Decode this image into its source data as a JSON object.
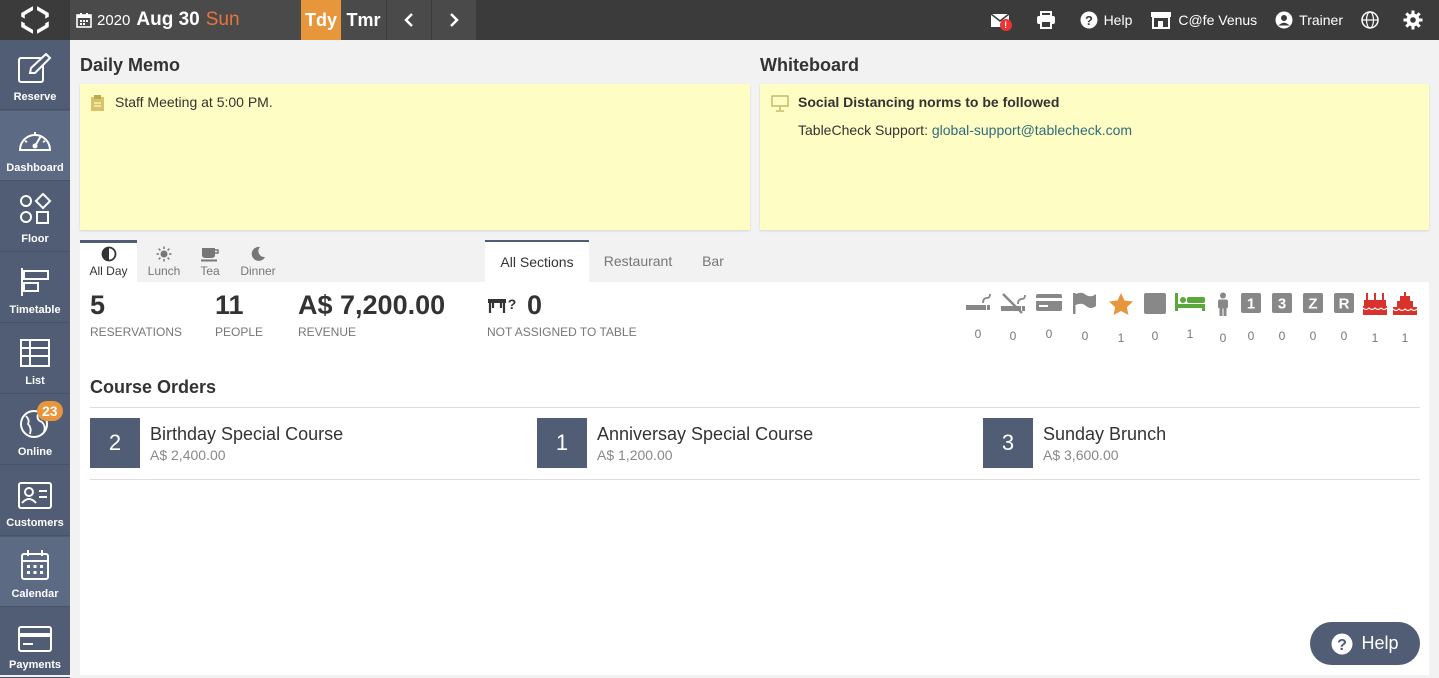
{
  "header": {
    "date_year": "2020",
    "date_monthday": "Aug 30",
    "date_weekday": "Sun",
    "today_label": "Tdy",
    "tomorrow_label": "Tmr",
    "mail_badge": "!",
    "help_label": "Help",
    "store_label": "C@fe Venus",
    "user_label": "Trainer"
  },
  "sidebar": {
    "items": [
      {
        "label": "Reserve",
        "icon": "edit-icon"
      },
      {
        "label": "Dashboard",
        "icon": "gauge-icon"
      },
      {
        "label": "Floor",
        "icon": "floor-icon"
      },
      {
        "label": "Timetable",
        "icon": "timetable-icon"
      },
      {
        "label": "List",
        "icon": "list-icon"
      },
      {
        "label": "Online",
        "icon": "globe-icon",
        "badge": "23"
      },
      {
        "label": "Customers",
        "icon": "customers-icon"
      },
      {
        "label": "Calendar",
        "icon": "calendar-icon"
      },
      {
        "label": "Payments",
        "icon": "card-icon"
      }
    ]
  },
  "memo": {
    "title": "Daily Memo",
    "text": "Staff Meeting at 5:00 PM."
  },
  "whiteboard": {
    "title": "Whiteboard",
    "headline": "Social Distancing norms to be followed",
    "support_prefix": "TableCheck Support: ",
    "support_email": "global-support@tablecheck.com"
  },
  "time_tabs": [
    "All Day",
    "Lunch",
    "Tea",
    "Dinner"
  ],
  "section_tabs": [
    "All Sections",
    "Restaurant",
    "Bar"
  ],
  "stats": {
    "reservations_value": "5",
    "reservations_label": "RESERVATIONS",
    "people_value": "11",
    "people_label": "PEOPLE",
    "revenue_value": "A$ 7,200.00",
    "revenue_label": "REVENUE",
    "unassigned_value": "0",
    "unassigned_label": "NOT ASSIGNED TO TABLE"
  },
  "attributes": [
    {
      "icon": "smoking-icon",
      "count": "0"
    },
    {
      "icon": "no-smoking-icon",
      "count": "0"
    },
    {
      "icon": "card-icon",
      "count": "0"
    },
    {
      "icon": "flag-icon",
      "count": "0"
    },
    {
      "icon": "star-icon",
      "count": "1"
    },
    {
      "icon": "square-icon",
      "count": "0"
    },
    {
      "icon": "bed-icon",
      "count": "1"
    },
    {
      "icon": "person-icon",
      "count": "0"
    },
    {
      "icon": "one-icon",
      "count": "0",
      "text": "1"
    },
    {
      "icon": "three-icon",
      "count": "0",
      "text": "3"
    },
    {
      "icon": "z-icon",
      "count": "0",
      "text": "Z"
    },
    {
      "icon": "r-icon",
      "count": "0",
      "text": "R"
    },
    {
      "icon": "birthday-cake-icon",
      "count": "1"
    },
    {
      "icon": "anniversary-cake-icon",
      "count": "1"
    }
  ],
  "courses": {
    "title": "Course Orders",
    "items": [
      {
        "qty": "2",
        "name": "Birthday Special Course",
        "price": "A$ 2,400.00"
      },
      {
        "qty": "1",
        "name": "Anniversay Special Course",
        "price": "A$ 1,200.00"
      },
      {
        "qty": "3",
        "name": "Sunday Brunch",
        "price": "A$ 3,600.00"
      }
    ]
  },
  "help_button": "Help",
  "colors": {
    "sidebar": "#515d75",
    "topbar": "#3b3b3b",
    "accent_orange": "#e8963b",
    "memo_yellow": "#fefec4",
    "star": "#e8963b",
    "bed": "#5aa83a",
    "cake": "#d9322d"
  }
}
